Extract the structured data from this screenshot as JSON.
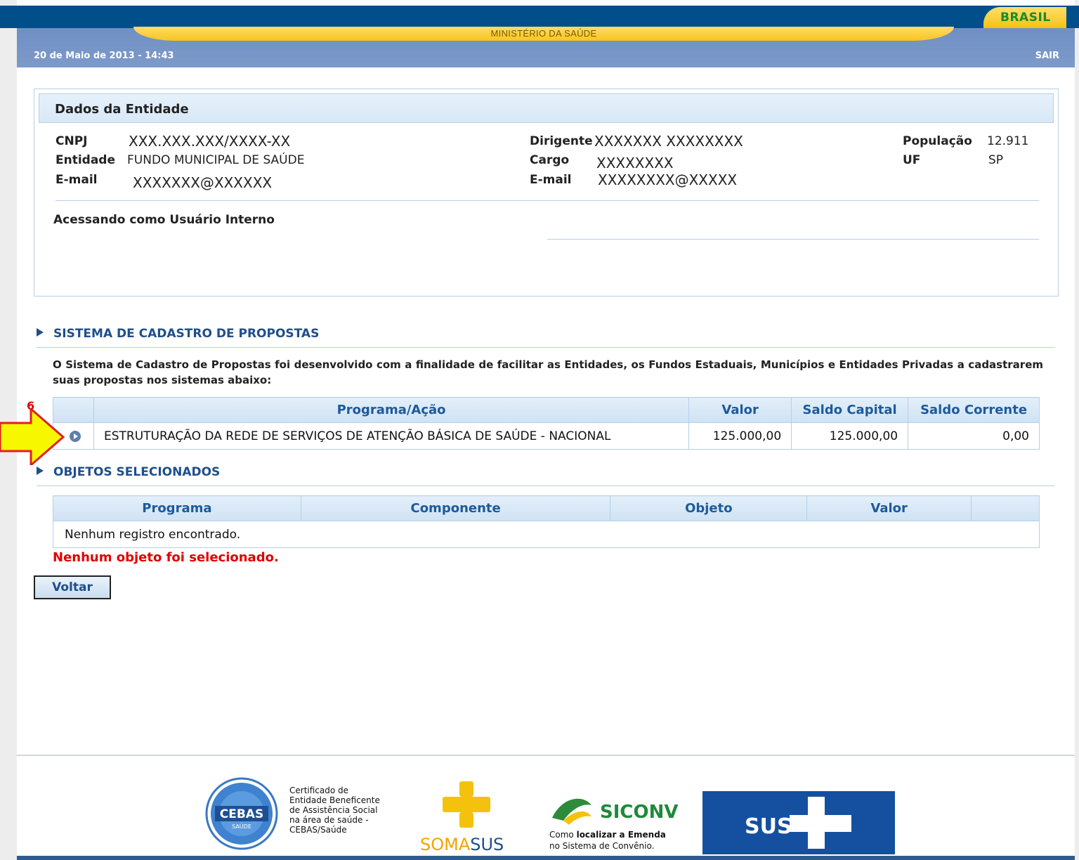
{
  "header": {
    "ministry": "MINISTÉRIO DA SAÚDE",
    "brasil": "BRASIL",
    "datetime": "20 de Maio de 2013  - 14:43",
    "logout": "SAIR"
  },
  "entity": {
    "title": "Dados da Entidade",
    "cnpj_label": "CNPJ",
    "cnpj_value": "XXX.XXX.XXX/XXXX-XX",
    "entidade_label": "Entidade",
    "entidade_value": "FUNDO MUNICIPAL DE SAÚDE",
    "email_label": "E-mail",
    "email_value": "XXXXXXX@XXXXXX",
    "dirigente_label": "Dirigente",
    "dirigente_value": "XXXXXXX XXXXXXXX",
    "cargo_label": "Cargo",
    "cargo_value": "XXXXXXXX",
    "email2_label": "E-mail",
    "email2_value": "XXXXXXXX@XXXXX",
    "populacao_label": "População",
    "populacao_value": "12.911",
    "uf_label": "UF",
    "uf_value": "SP",
    "access_note": "Acessando como Usuário Interno"
  },
  "sistema": {
    "title": "SISTEMA DE CADASTRO DE PROPOSTAS",
    "intro": "O Sistema de Cadastro de Propostas foi desenvolvido com a finalidade de facilitar as Entidades, os Fundos Estaduais, Municípios e Entidades Privadas a cadastrarem suas propostas nos sistemas abaixo:",
    "columns": [
      "",
      "Programa/Ação",
      "Valor",
      "Saldo Capital",
      "Saldo Corrente"
    ],
    "rows": [
      {
        "programa": "ESTRUTURAÇÃO DA REDE DE SERVIÇOS DE ATENÇÃO BÁSICA DE SAÚDE - NACIONAL",
        "valor": "125.000,00",
        "saldo_capital": "125.000,00",
        "saldo_corrente": "0,00"
      }
    ]
  },
  "annotation": {
    "step_number": "6",
    "arrow_color": "#f7f700"
  },
  "objetos": {
    "title": "OBJETOS SELECIONADOS",
    "columns": [
      "Programa",
      "Componente",
      "Objeto",
      "Valor",
      ""
    ],
    "empty_row": "Nenhum registro encontrado.",
    "empty_message": "Nenhum objeto foi selecionado."
  },
  "actions": {
    "back": "Voltar"
  },
  "footer": {
    "cebas_logo": "CEBAS",
    "cebas_sub": "SAÚDE",
    "cebas_text": [
      "Certificado de",
      "Entidade Beneficente",
      "de Assistência Social",
      "na área de saúde -",
      "CEBAS/Saúde"
    ],
    "soma": "SOMA",
    "sus_suffix": "SUS",
    "siconv": "SICONV",
    "siconv_line1_pre": "Como ",
    "siconv_line1_bold": "localizar a Emenda",
    "siconv_line2": "no Sistema de Convênio.",
    "sus": "SUS"
  },
  "colors": {
    "primary": "#004e8a",
    "accent_yellow": "#f8c51d",
    "link_blue": "#1d4f8c",
    "error_red": "#e00000"
  }
}
